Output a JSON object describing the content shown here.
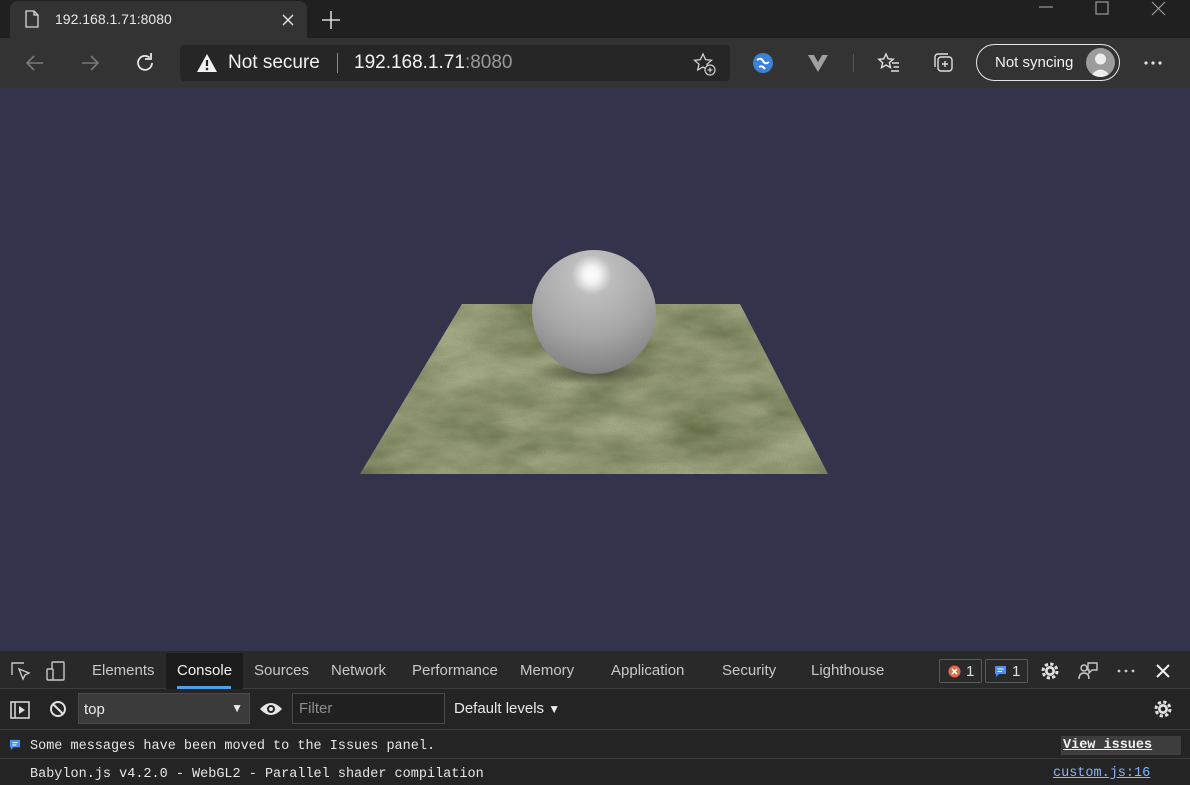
{
  "tab": {
    "title": "192.168.1.71:8080",
    "favicon": "page-icon"
  },
  "window_controls": [
    "minimize-icon",
    "maximize-icon",
    "close-icon"
  ],
  "address_bar": {
    "security_label": "Not secure",
    "host": "192.168.1.71",
    "port": ":8080"
  },
  "profile": {
    "sync_label": "Not syncing"
  },
  "devtools": {
    "tabs": [
      "Elements",
      "Console",
      "Sources",
      "Network",
      "Performance",
      "Memory",
      "Application",
      "Security",
      "Lighthouse"
    ],
    "active_tab": "Console",
    "error_count": "1",
    "issue_count": "1",
    "console": {
      "context": "top",
      "filter_placeholder": "Filter",
      "levels_label": "Default levels"
    },
    "messages": [
      {
        "text": "Some messages have been moved to the Issues panel.",
        "action": "View issues"
      },
      {
        "text": "Babylon.js v4.2.0 - WebGL2 - Parallel shader compilation",
        "source": "custom.js:16"
      }
    ]
  },
  "colors": {
    "scene_background": "#33334c",
    "accent": "#4d9fea",
    "error_badge": "#e06a4a",
    "issue_badge": "#4d8ff0"
  }
}
